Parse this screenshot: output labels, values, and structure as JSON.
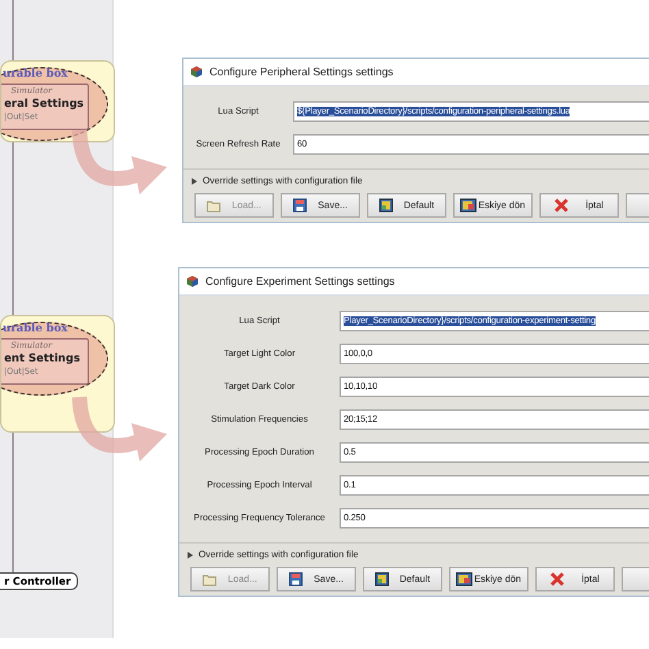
{
  "diagram": {
    "boxes": [
      {
        "header": "urable box",
        "subtitle": "Simulator",
        "title": "eral Settings",
        "ports": "|Out|Set"
      },
      {
        "header": "urable box",
        "subtitle": "Simulator",
        "title": "ent Settings",
        "ports": "|Out|Set"
      }
    ],
    "end_node": "r Controller"
  },
  "dialogs": [
    {
      "title": "Configure Peripheral Settings settings",
      "fields": [
        {
          "label": "Lua Script",
          "value": "${Player_ScenarioDirectory}/scripts/configuration-peripheral-settings.lua",
          "selected": true
        },
        {
          "label": "Screen Refresh Rate",
          "value": "60",
          "selected": false
        }
      ],
      "override": "Override settings with configuration file",
      "buttons": [
        {
          "kind": "load",
          "label": "Load...",
          "disabled": true
        },
        {
          "kind": "save",
          "label": "Save...",
          "disabled": false
        },
        {
          "kind": "default",
          "label": "Default",
          "disabled": false
        },
        {
          "kind": "revert",
          "label": "Eskiye dön",
          "disabled": false
        },
        {
          "kind": "cancel",
          "label": "İptal",
          "disabled": false
        },
        {
          "kind": "blank"
        }
      ]
    },
    {
      "title": "Configure Experiment Settings settings",
      "fields": [
        {
          "label": "Lua Script",
          "value": "Player_ScenarioDirectory}/scripts/configuration-experiment-setting",
          "selected": true
        },
        {
          "label": "Target Light Color",
          "value": "100,0,0",
          "selected": false
        },
        {
          "label": "Target Dark Color",
          "value": "10,10,10",
          "selected": false
        },
        {
          "label": "Stimulation Frequencies",
          "value": "20;15;12",
          "selected": false
        },
        {
          "label": "Processing Epoch Duration",
          "value": "0.5",
          "selected": false
        },
        {
          "label": "Processing Epoch Interval",
          "value": "0.1",
          "selected": false
        },
        {
          "label": "Processing Frequency Tolerance",
          "value": "0.250",
          "selected": false
        }
      ],
      "override": "Override settings with configuration file",
      "buttons": [
        {
          "kind": "load",
          "label": "Load...",
          "disabled": true
        },
        {
          "kind": "save",
          "label": "Save...",
          "disabled": false
        },
        {
          "kind": "default",
          "label": "Default",
          "disabled": false
        },
        {
          "kind": "revert",
          "label": "Eskiye dön",
          "disabled": false
        },
        {
          "kind": "cancel",
          "label": "İptal",
          "disabled": false
        },
        {
          "kind": "blank"
        }
      ]
    }
  ]
}
